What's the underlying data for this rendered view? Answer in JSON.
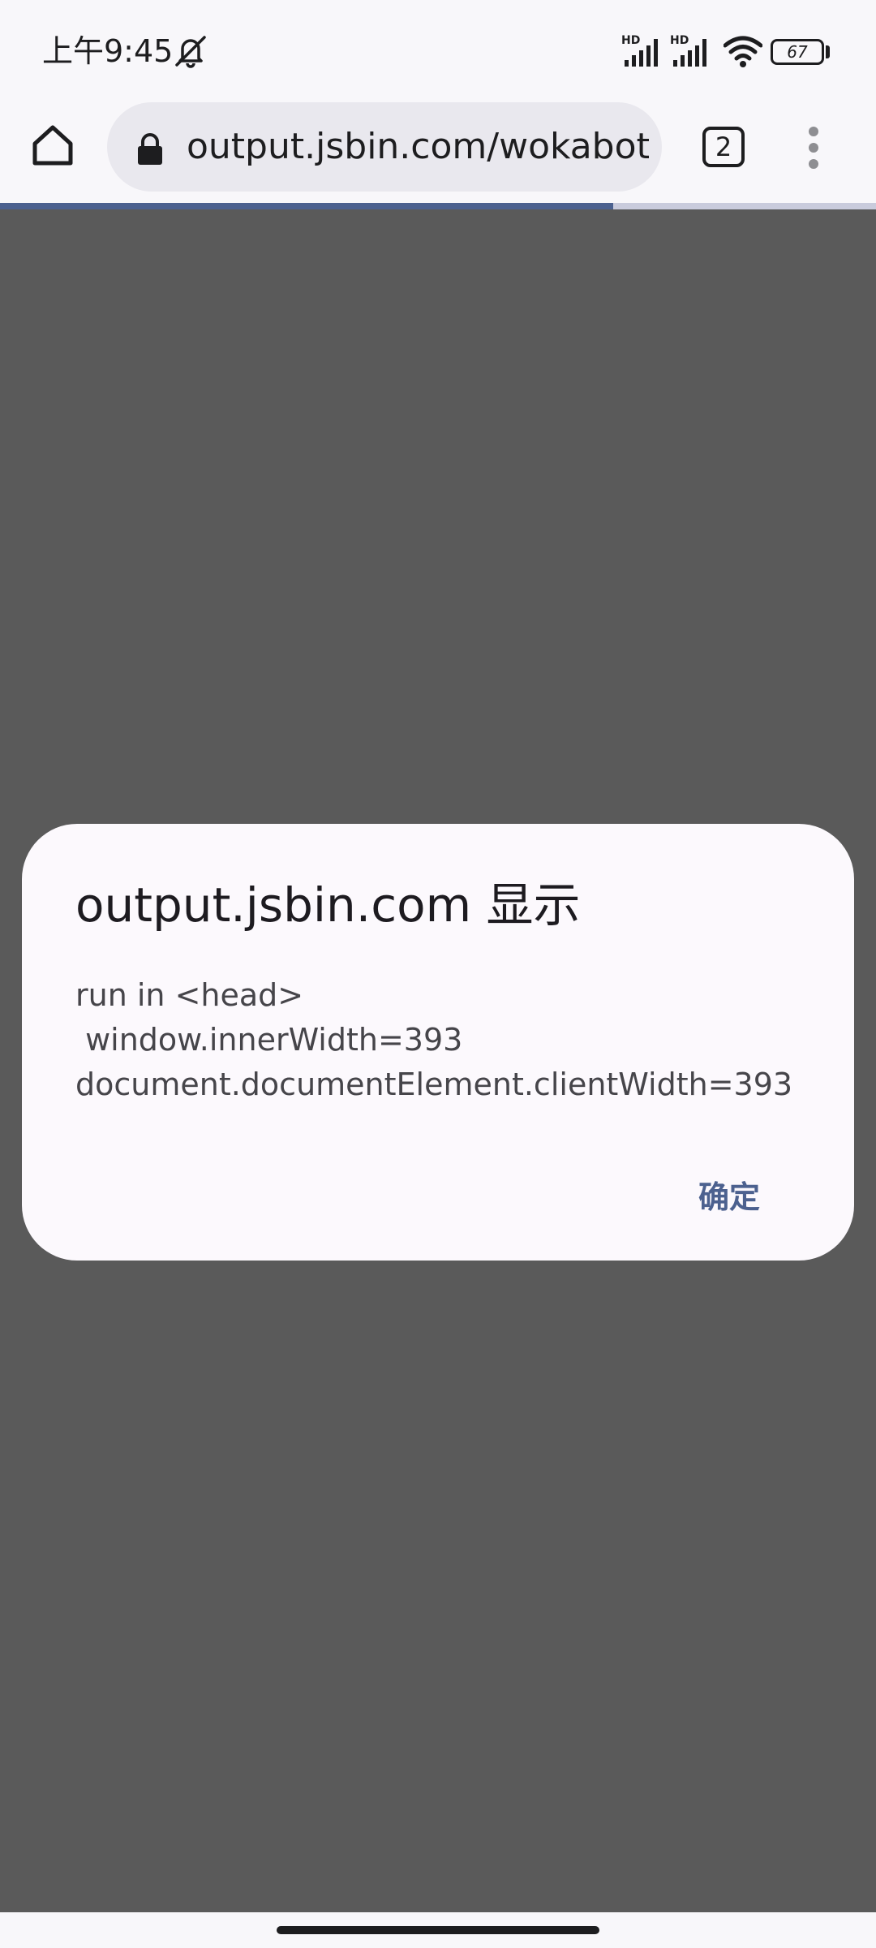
{
  "status_bar": {
    "time": "上午9:45",
    "signal1_label": "HD",
    "signal2_label": "HD",
    "battery_level": "67",
    "icons": [
      "mute-icon",
      "signal-icon",
      "signal-icon",
      "wifi-icon",
      "battery-icon"
    ]
  },
  "toolbar": {
    "url": "output.jsbin.com/wokabot",
    "tab_count": "2",
    "page_load_progress": 0.7,
    "icons": [
      "home-icon",
      "lock-icon",
      "tab-switcher-icon",
      "more-vert-icon"
    ]
  },
  "dialog": {
    "title": "output.jsbin.com 显示",
    "message": "run in <head>\n window.innerWidth=393\ndocument.documentElement.clientWidth=393",
    "ok_label": "确定"
  },
  "colors": {
    "accent": "#4c618f",
    "scrim": "#5a5a5a",
    "dialog_bg": "#fcf9fd"
  }
}
